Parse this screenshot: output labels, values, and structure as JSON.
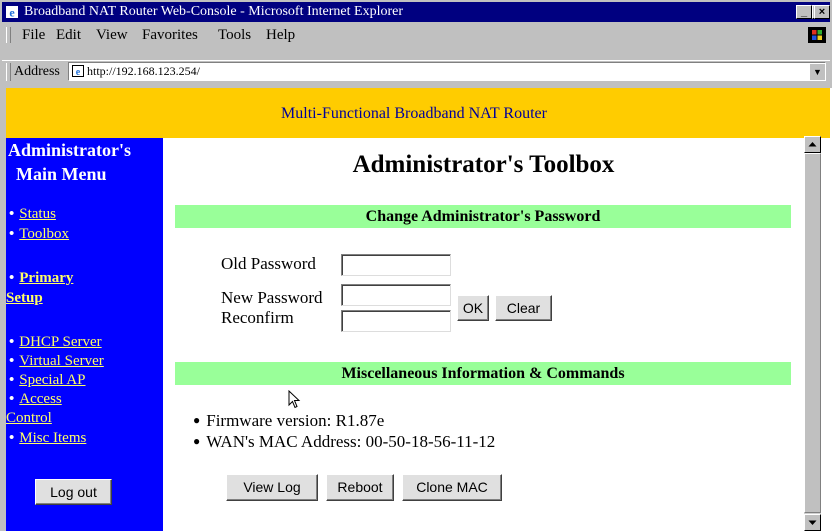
{
  "window": {
    "title": "Broadband NAT Router Web-Console - Microsoft Internet Explorer",
    "controls": [
      "_",
      "□",
      "×"
    ]
  },
  "menubar": {
    "items": [
      "File",
      "Edit",
      "View",
      "Favorites",
      "Tools",
      "Help"
    ]
  },
  "address": {
    "label": "Address",
    "url": "http://192.168.123.254/"
  },
  "banner": {
    "text": "Multi-Functional Broadband NAT Router"
  },
  "sidebar": {
    "title_line1": "Administrator's",
    "title_line2": "Main Menu",
    "items": [
      {
        "label": "Status"
      },
      {
        "label": "Toolbox"
      },
      {
        "label": "Primary",
        "label_cont": "Setup"
      },
      {
        "label": "DHCP Server"
      },
      {
        "label": "Virtual Server"
      },
      {
        "label": "Special AP"
      },
      {
        "label": "Access",
        "label_cont": "Control"
      },
      {
        "label": "Misc Items"
      }
    ],
    "logout_label": "Log out"
  },
  "main": {
    "title": "Administrator's Toolbox",
    "password_section": {
      "heading": "Change Administrator's Password",
      "old_label": "Old Password",
      "new_label": "New Password",
      "reconfirm_label": "Reconfirm",
      "old_value": "",
      "new_value": "",
      "reconfirm_value": "",
      "ok_label": "OK",
      "clear_label": "Clear"
    },
    "misc_section": {
      "heading": "Miscellaneous Information & Commands",
      "firmware": "Firmware version: R1.87e",
      "mac": "WAN's MAC Address: 00-50-18-56-11-12",
      "view_log_label": "View Log",
      "reboot_label": "Reboot",
      "clone_mac_label": "Clone MAC"
    }
  },
  "colors": {
    "titlebar": "#000080",
    "banner_bg": "#ffcc00",
    "banner_text": "#00009a",
    "sidebar_bg": "#0000ff",
    "sidebar_link": "#ffff66",
    "section_bg": "#99ff99"
  },
  "icons": {
    "app_icon": "ie-icon",
    "page_icon": "page-icon",
    "windows_logo": "windows-logo-icon",
    "cursor": "mouse-cursor-icon"
  }
}
